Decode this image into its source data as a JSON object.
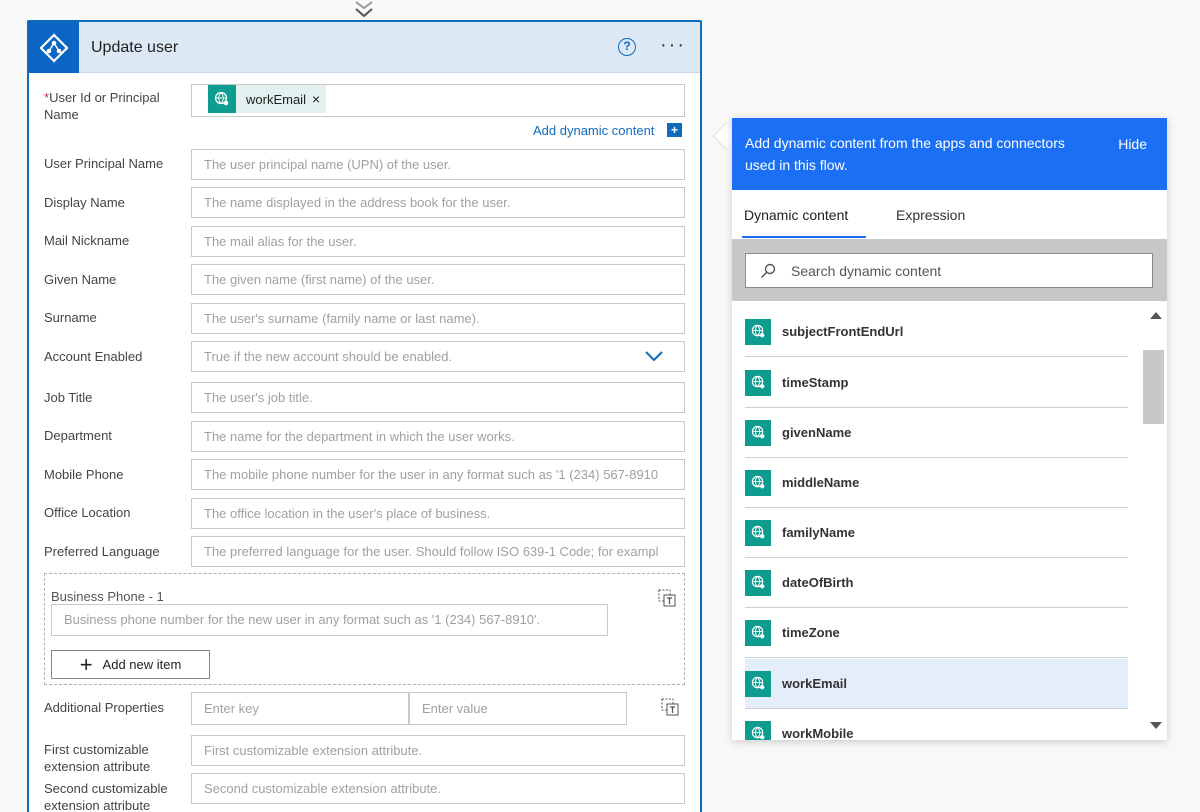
{
  "card": {
    "title": "Update user",
    "help_icon": "question-circle-icon",
    "more_icon": "ellipsis-icon",
    "more_glyph": "···"
  },
  "form": {
    "user_id": {
      "required_marker": "*",
      "label": "User Id or Principal Name",
      "token": "workEmail",
      "token_remove": "×"
    },
    "add_dynamic_content": "Add dynamic content",
    "add_dynamic_plus": "+",
    "fields": [
      {
        "label": "User Principal Name",
        "placeholder": "The user principal name (UPN) of the user."
      },
      {
        "label": "Display Name",
        "placeholder": "The name displayed in the address book for the user."
      },
      {
        "label": "Mail Nickname",
        "placeholder": "The mail alias for the user."
      },
      {
        "label": "Given Name",
        "placeholder": "The given name (first name) of the user."
      },
      {
        "label": "Surname",
        "placeholder": "The user's surname (family name or last name)."
      },
      {
        "label": "Account Enabled",
        "placeholder": "True if the new account should be enabled."
      },
      {
        "label": "Job Title",
        "placeholder": "The user's job title."
      },
      {
        "label": "Department",
        "placeholder": "The name for the department in which the user works."
      },
      {
        "label": "Mobile Phone",
        "placeholder": "The mobile phone number for the user in any format such as '1 (234) 567-8910"
      },
      {
        "label": "Office Location",
        "placeholder": "The office location in the user's place of business."
      },
      {
        "label": "Preferred Language",
        "placeholder": "The preferred language for the user. Should follow ISO 639-1 Code; for exampl"
      }
    ],
    "business_phone": {
      "label": "Business Phone - 1",
      "placeholder": "Business phone number for the new user in any format such as '1 (234) 567-8910'.",
      "add_item": "Add new item",
      "add_item_plus": "+"
    },
    "additional_properties": {
      "label": "Additional Properties",
      "key_placeholder": "Enter key",
      "value_placeholder": "Enter value"
    },
    "extensions": [
      {
        "label": "First customizable extension attribute",
        "placeholder": "First customizable extension attribute."
      },
      {
        "label": "Second customizable extension attribute",
        "placeholder": "Second customizable extension attribute."
      }
    ]
  },
  "panel": {
    "header_text": "Add dynamic content from the apps and connectors used in this flow.",
    "hide_label": "Hide",
    "tabs": [
      "Dynamic content",
      "Expression"
    ],
    "active_tab": "Dynamic content",
    "search_placeholder": "Search dynamic content",
    "items": [
      "subjectFrontEndUrl",
      "timeStamp",
      "givenName",
      "middleName",
      "familyName",
      "dateOfBirth",
      "timeZone",
      "workEmail",
      "workMobile"
    ],
    "selected_item": "workEmail"
  },
  "colors": {
    "accent": "#1a6ff5",
    "card_border": "#0f6cbd",
    "token_icon": "#0e9c8e",
    "header_bg": "#dce9f5",
    "selected_bg": "#e4eefb"
  }
}
